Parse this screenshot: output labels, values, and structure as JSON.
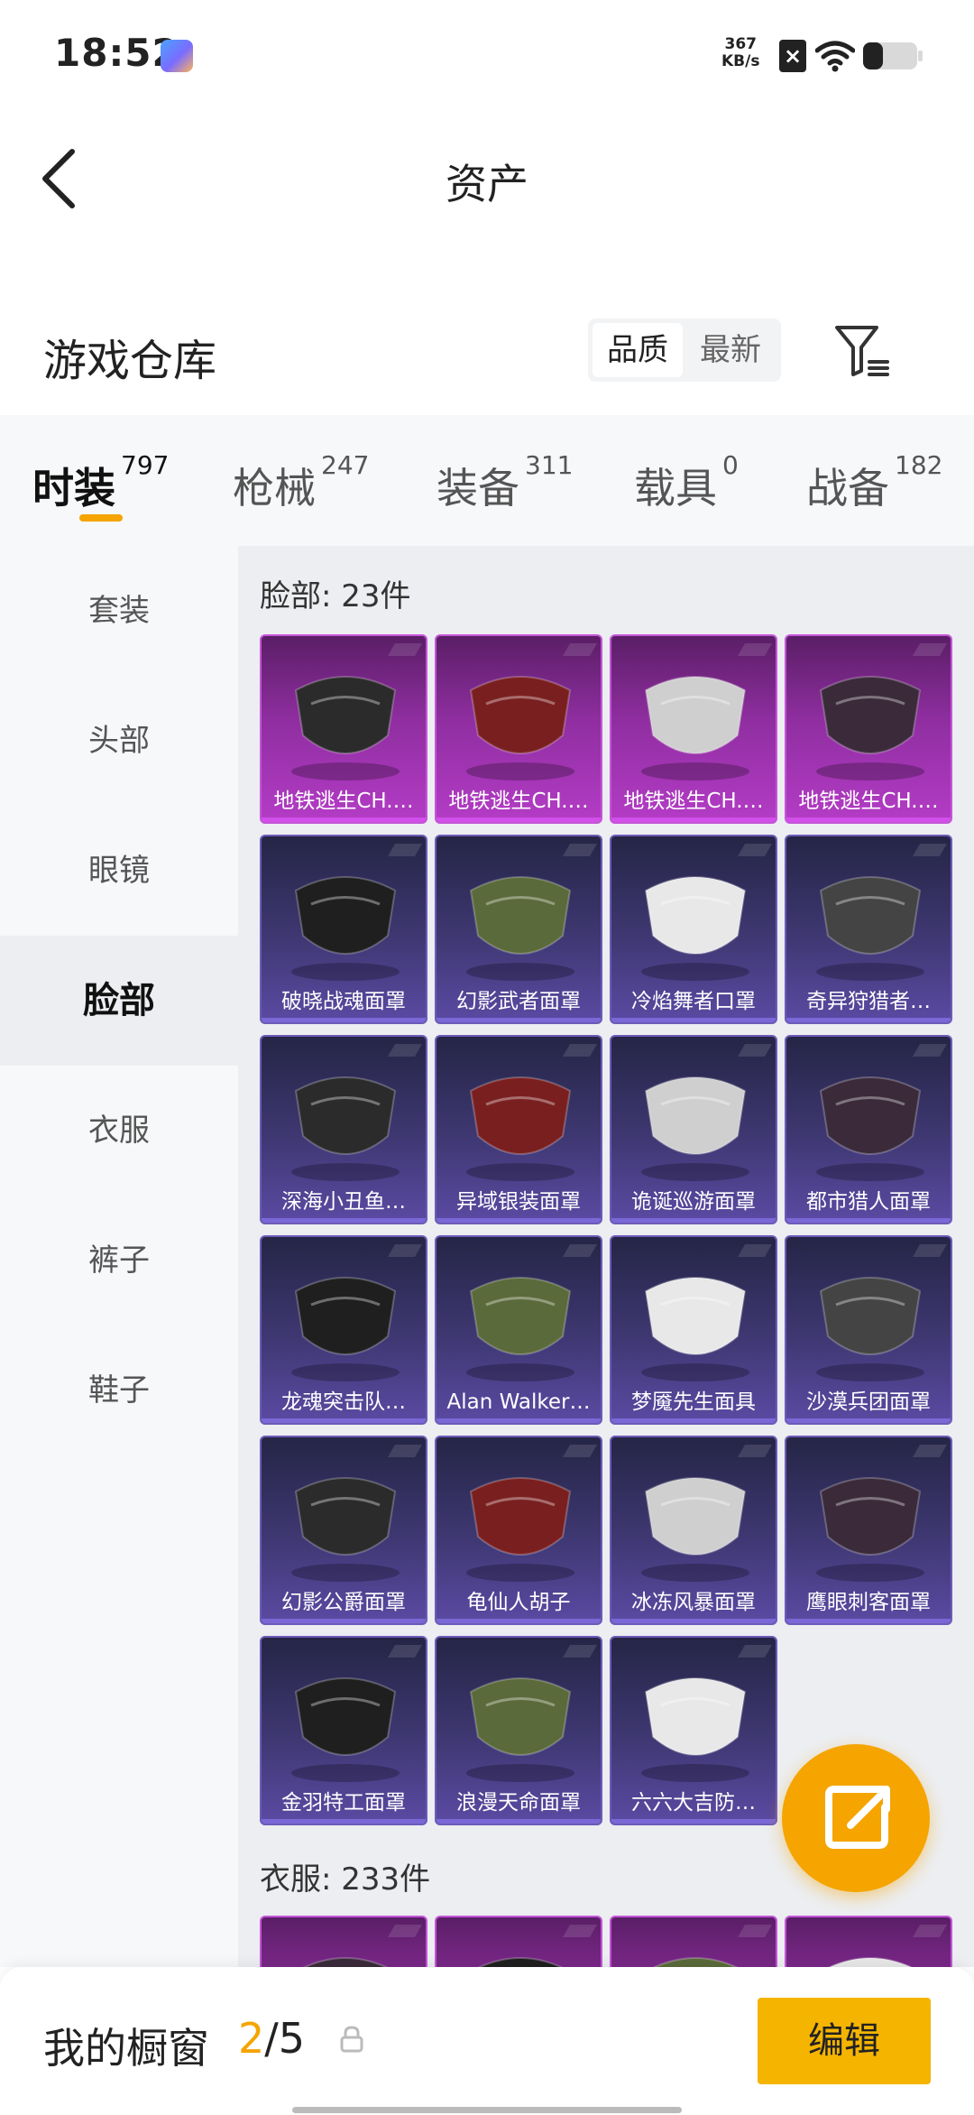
{
  "status_bar": {
    "time": "18:52",
    "net_speed_value": "367",
    "net_speed_unit": "KB/s",
    "icons": [
      "app-badge-icon",
      "no-sim-icon",
      "wifi-icon",
      "battery-icon"
    ]
  },
  "header": {
    "title": "资产",
    "back_icon": "chevron-left-icon"
  },
  "warehouse": {
    "title": "游戏仓库",
    "sort_options": [
      "品质",
      "最新"
    ],
    "sort_selected": "品质",
    "filter_icon": "filter-icon"
  },
  "tabs": [
    {
      "label": "时装",
      "count": "797",
      "active": true
    },
    {
      "label": "枪械",
      "count": "247",
      "active": false
    },
    {
      "label": "装备",
      "count": "311",
      "active": false
    },
    {
      "label": "载具",
      "count": "0",
      "active": false
    },
    {
      "label": "战备",
      "count": "182",
      "active": false
    }
  ],
  "sidebar": {
    "items": [
      "套装",
      "头部",
      "眼镜",
      "脸部",
      "衣服",
      "裤子",
      "鞋子"
    ],
    "active": "脸部"
  },
  "sections": {
    "face": {
      "title": "脸部: 23件",
      "items": [
        {
          "name": "地铁逃生CH.…",
          "rarity": "purple"
        },
        {
          "name": "地铁逃生CH.…",
          "rarity": "purple"
        },
        {
          "name": "地铁逃生CH.…",
          "rarity": "purple"
        },
        {
          "name": "地铁逃生CH.…",
          "rarity": "purple"
        },
        {
          "name": "破晓战魂面罩",
          "rarity": "blue"
        },
        {
          "name": "幻影武者面罩",
          "rarity": "blue"
        },
        {
          "name": "冷焰舞者口罩",
          "rarity": "blue"
        },
        {
          "name": "奇异狩猎者…",
          "rarity": "blue"
        },
        {
          "name": "深海小丑鱼…",
          "rarity": "blue"
        },
        {
          "name": "异域银装面罩",
          "rarity": "blue"
        },
        {
          "name": "诡诞巡游面罩",
          "rarity": "blue"
        },
        {
          "name": "都市猎人面罩",
          "rarity": "blue"
        },
        {
          "name": "龙魂突击队…",
          "rarity": "blue"
        },
        {
          "name": "Alan Walker…",
          "rarity": "blue"
        },
        {
          "name": "梦魇先生面具",
          "rarity": "blue"
        },
        {
          "name": "沙漠兵团面罩",
          "rarity": "blue"
        },
        {
          "name": "幻影公爵面罩",
          "rarity": "blue"
        },
        {
          "name": "龟仙人胡子",
          "rarity": "blue"
        },
        {
          "name": "冰冻风暴面罩",
          "rarity": "blue"
        },
        {
          "name": "鹰眼刺客面罩",
          "rarity": "blue"
        },
        {
          "name": "金羽特工面罩",
          "rarity": "blue"
        },
        {
          "name": "浪漫天命面罩",
          "rarity": "blue"
        },
        {
          "name": "六六大吉防…",
          "rarity": "blue"
        }
      ]
    },
    "clothes": {
      "title": "衣服: 233件",
      "visible_cards": 4
    }
  },
  "fab_icon": "share-icon",
  "bottom_bar": {
    "label": "我的橱窗",
    "current": "2",
    "separator": "/",
    "total": "5",
    "lock_icon": "lock-icon",
    "edit_label": "编辑"
  },
  "colors": {
    "accent": "#f5a400",
    "purple_rarity": "#b43cc6",
    "blue_rarity": "#5b4aa3"
  }
}
